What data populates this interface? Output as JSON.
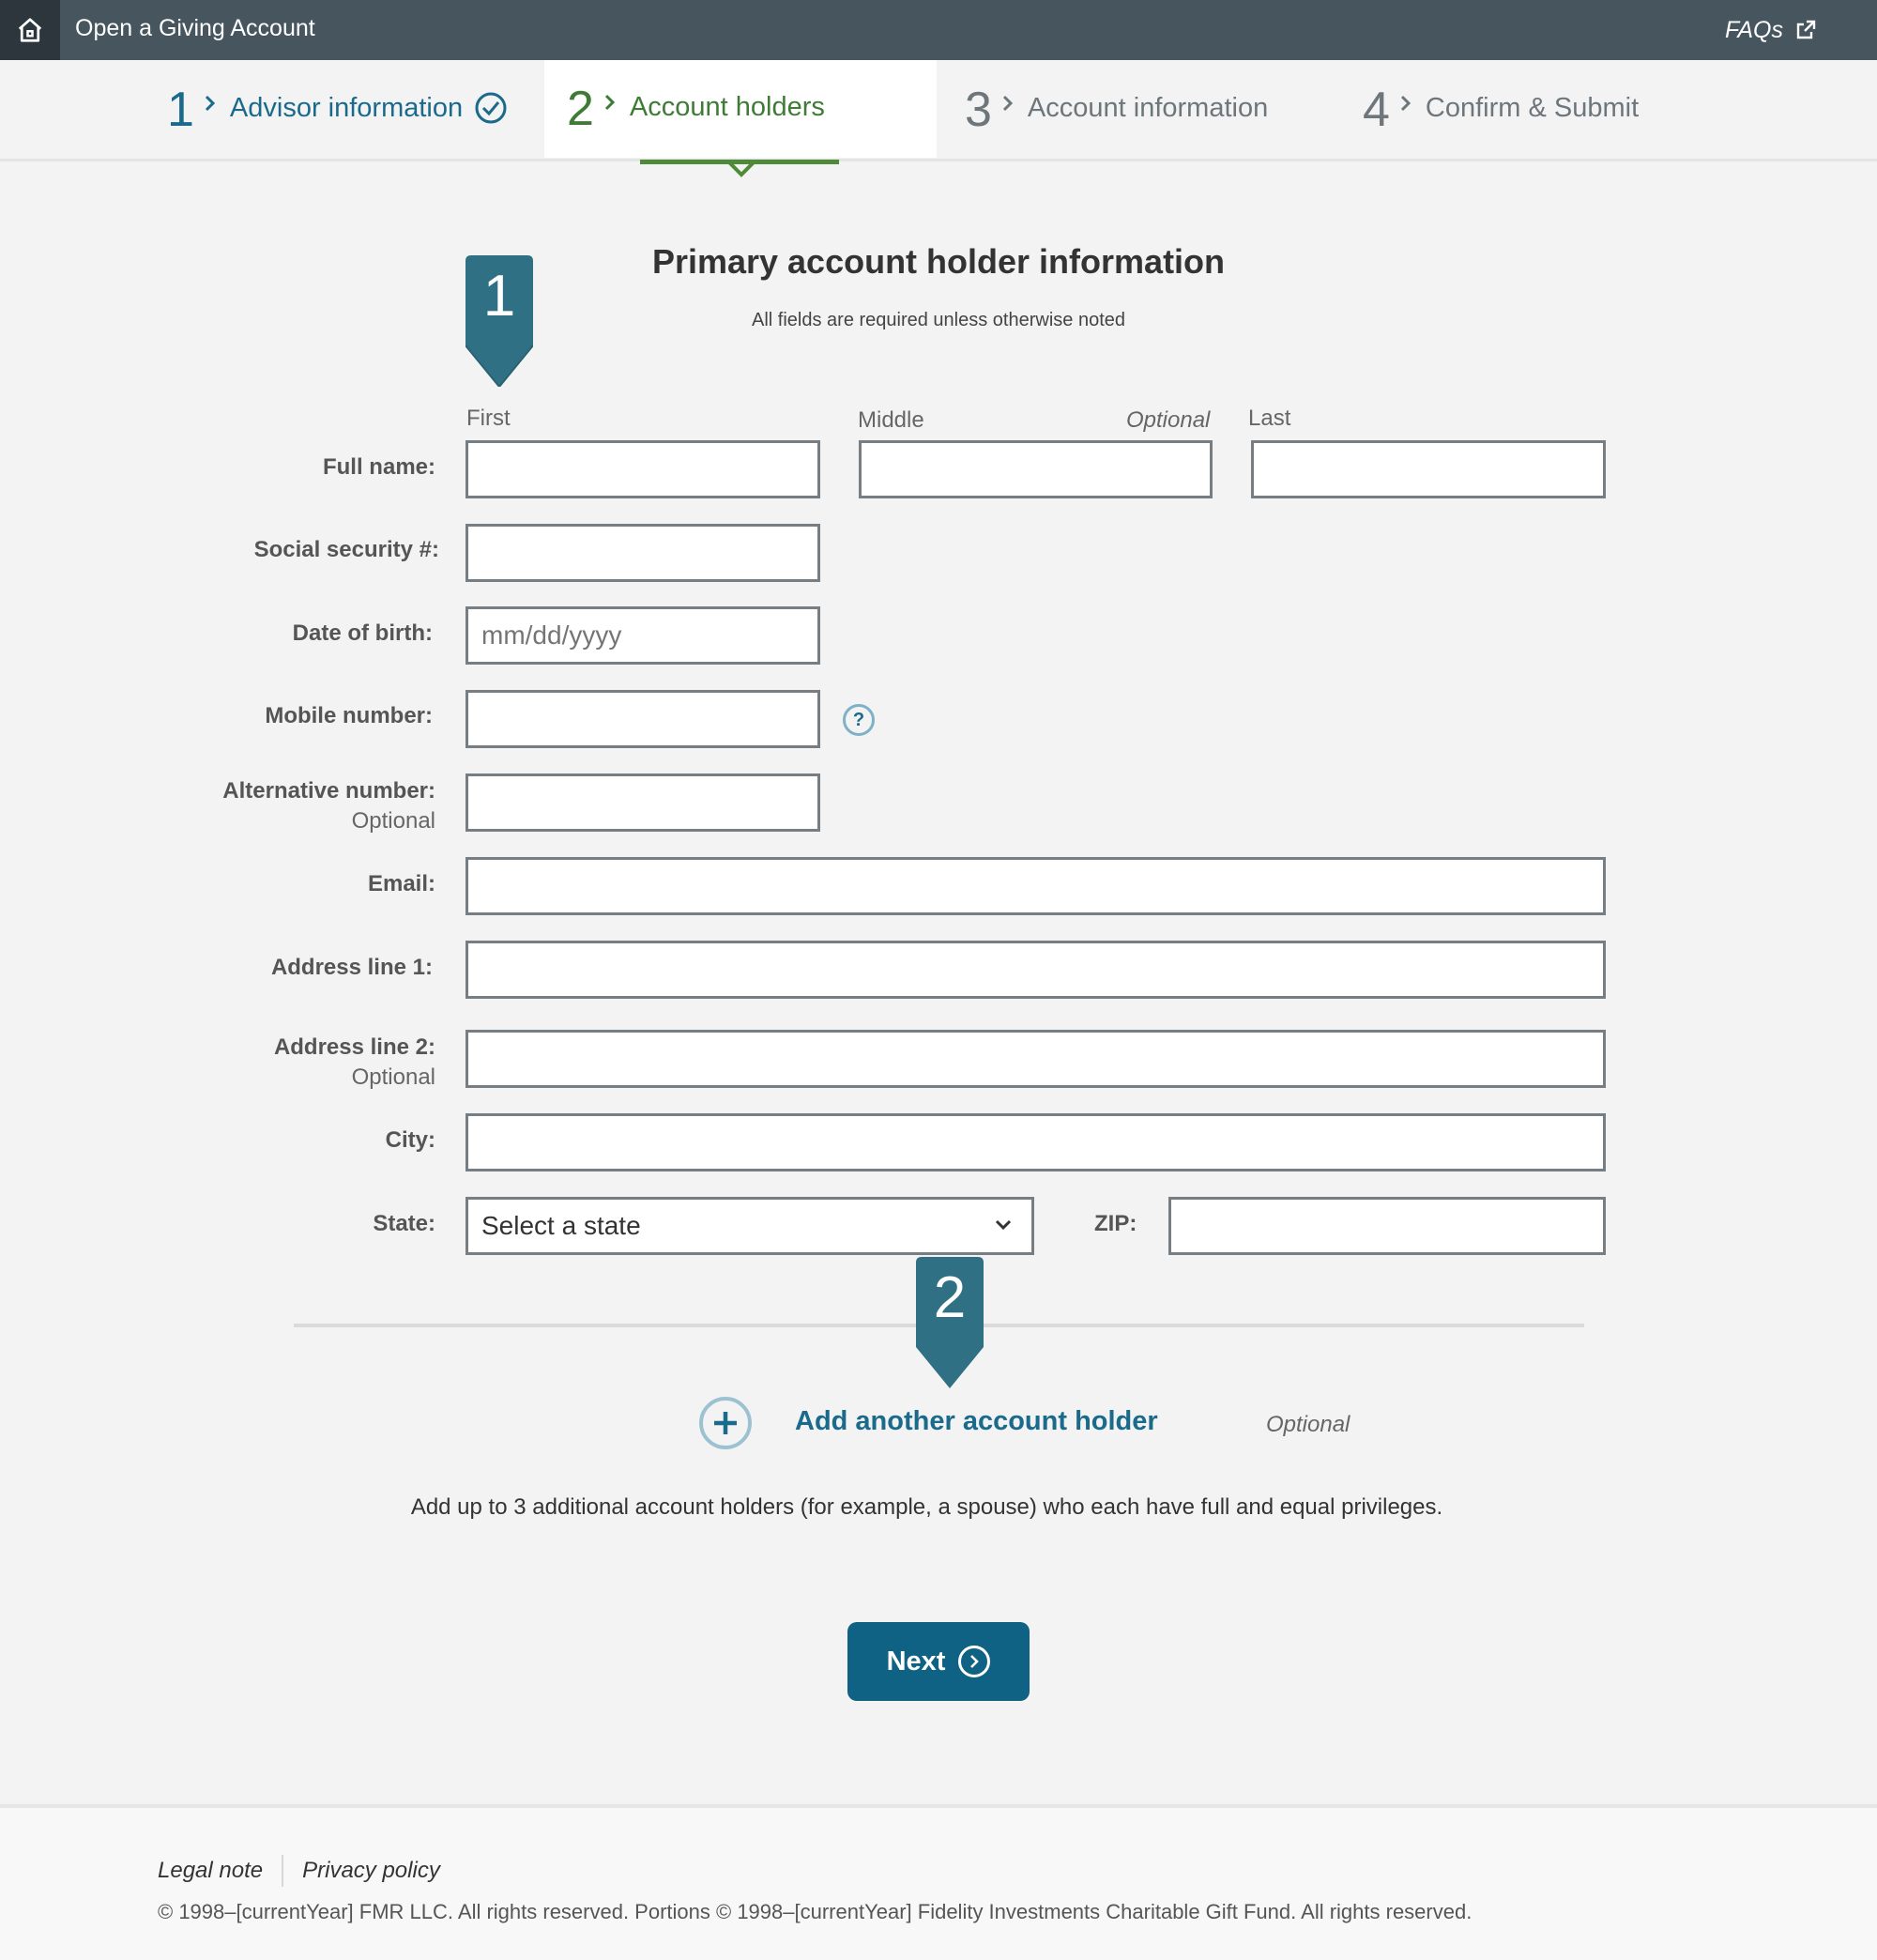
{
  "header": {
    "title": "Open a Giving Account",
    "faqs_label": "FAQs"
  },
  "steps": [
    {
      "num": "1",
      "label": "Advisor information",
      "state": "complete"
    },
    {
      "num": "2",
      "label": "Account holders",
      "state": "active"
    },
    {
      "num": "3",
      "label": "Account information",
      "state": "upcoming"
    },
    {
      "num": "4",
      "label": "Confirm & Submit",
      "state": "upcoming"
    }
  ],
  "form": {
    "title": "Primary account holder information",
    "subtitle": "All fields are required unless otherwise noted",
    "name_parts": {
      "first": "First",
      "middle": "Middle",
      "middle_optional": "Optional",
      "last": "Last"
    },
    "labels": {
      "full_name": "Full name:",
      "ssn": "Social security #:",
      "dob": "Date of birth:",
      "mobile": "Mobile number:",
      "alt_number": "Alternative number:",
      "alt_optional": "Optional",
      "email": "Email:",
      "address1": "Address line 1:",
      "address2": "Address line 2:",
      "address2_optional": "Optional",
      "city": "City:",
      "state": "State:",
      "zip": "ZIP:"
    },
    "placeholders": {
      "dob": "mm/dd/yyyy"
    },
    "state_select_value": "Select a state",
    "help_symbol": "?"
  },
  "markers": [
    "1",
    "2"
  ],
  "add_holder": {
    "link": "Add another account holder",
    "optional": "Optional",
    "description": "Add up to 3 additional account holders (for example, a spouse) who each have full and equal privileges."
  },
  "next_button": "Next",
  "footer": {
    "legal": "Legal note",
    "privacy": "Privacy policy",
    "copyright": "© 1998–[currentYear] FMR LLC. All rights reserved. Portions © 1998–[currentYear] Fidelity Investments Charitable Gift Fund. All rights reserved."
  },
  "icons": [
    "home-icon",
    "external-link-icon",
    "chevron-right-icon",
    "check-circle-icon",
    "chevron-down-icon",
    "help-icon",
    "plus-circle-icon",
    "arrow-right-circle-icon"
  ],
  "colors": {
    "header": "#46555e",
    "accent_blue": "#0f6283",
    "active_green": "#4f8a3a",
    "marker": "#2f7085"
  }
}
